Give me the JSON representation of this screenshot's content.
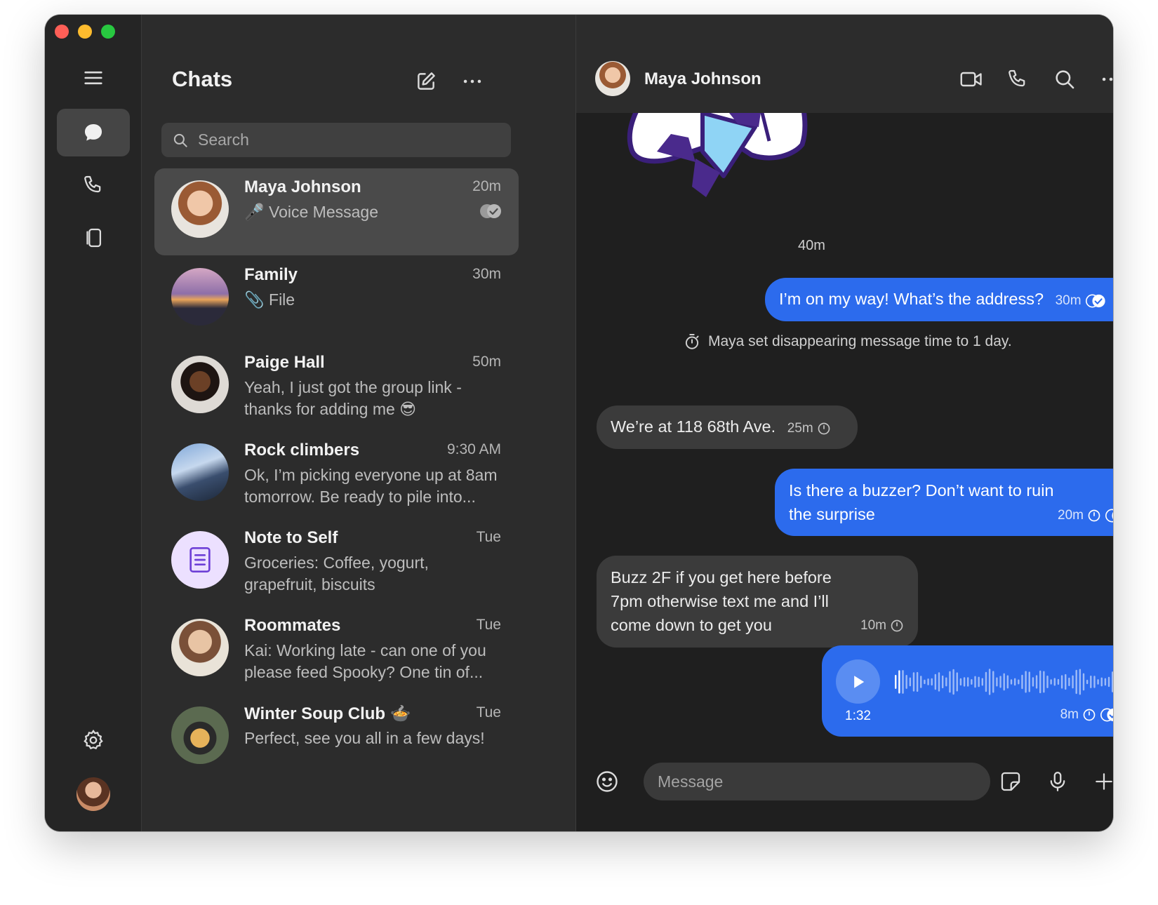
{
  "sidebar": {
    "nav": [
      "menu",
      "chats",
      "calls",
      "stories",
      "settings"
    ]
  },
  "chat_list": {
    "title": "Chats",
    "search_placeholder": "Search",
    "items": [
      {
        "name": "Maya Johnson",
        "time": "20m",
        "preview": "🎤 Voice Message"
      },
      {
        "name": "Family",
        "time": "30m",
        "preview": "📎 File"
      },
      {
        "name": "Paige Hall",
        "time": "50m",
        "preview": "Yeah, I just got the group link - thanks for adding me 😎"
      },
      {
        "name": "Rock climbers",
        "time": "9:30 AM",
        "preview": "Ok, I’m picking everyone up at 8am tomorrow. Be ready to pile into..."
      },
      {
        "name": "Note to Self",
        "time": "Tue",
        "preview": "Groceries: Coffee, yogurt, grapefruit, biscuits"
      },
      {
        "name": "Roommates",
        "time": "Tue",
        "preview": "Kai: Working late - can one of you please feed Spooky? One tin of..."
      },
      {
        "name": "Winter Soup Club 🍲",
        "time": "Tue",
        "preview": "Perfect, see you all in a few days!"
      }
    ]
  },
  "conversation": {
    "name": "Maya Johnson",
    "sticker_time": "40m",
    "messages": [
      {
        "text": "I’m on my way! What’s the address?",
        "time": "30m"
      },
      {
        "text": "Maya set disappearing message time to 1 day."
      },
      {
        "text": "We’re at 118 68th Ave.",
        "time": "25m"
      },
      {
        "text": "Is there a buzzer? Don’t want to ruin the surprise",
        "time": "20m"
      },
      {
        "text": "Buzz 2F if you get here before 7pm otherwise text me and I’ll come down to get you",
        "time": "10m"
      }
    ],
    "voice_message": {
      "duration": "1:32",
      "time": "8m"
    },
    "composer_placeholder": "Message"
  },
  "colors": {
    "outgoing_bubble": "#2c6bed",
    "incoming_bubble": "#3b3b3b",
    "window_bg": "#2c2c2c",
    "conversation_bg": "#1f1f1f"
  }
}
